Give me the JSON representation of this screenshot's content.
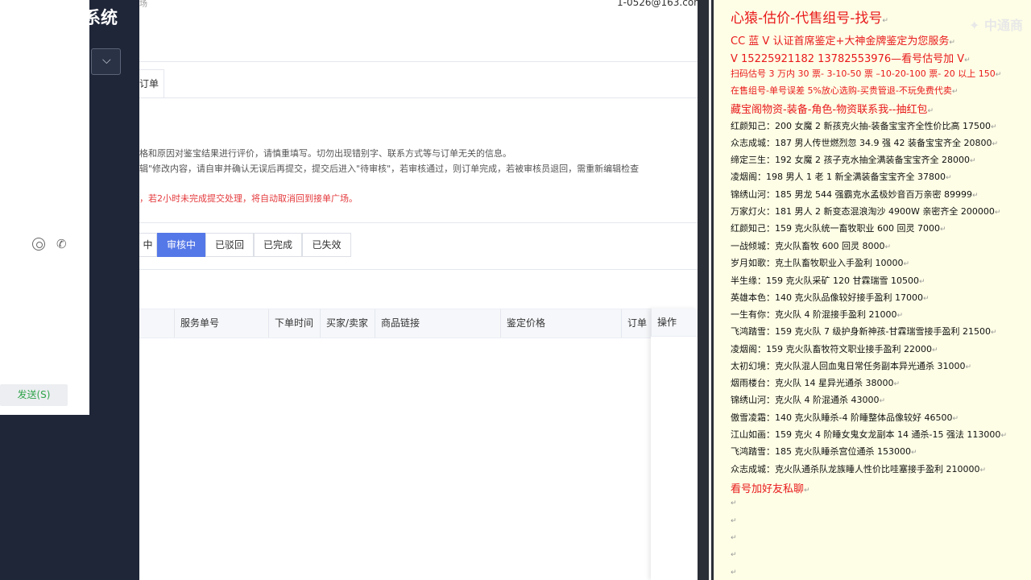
{
  "sidebar": {
    "system_title": "系统",
    "select_arrow": "⌵"
  },
  "chat": {
    "send_label": "发送(S)",
    "icons": [
      "target-icon",
      "phone-icon"
    ]
  },
  "page": {
    "top_hint": "场",
    "top_email": "1-0526@163.com",
    "order_tab": "订单",
    "notes": [
      "格和原因对鉴宝结果进行评价，请慎重填写。切勿出现错别字、联系方式等与订单无关的信息。",
      "辑\"修改内容，请自审并确认无误后再提交，提交后进入\"待审核\"，若审核通过，则订单完成，若被审核员退回，需重新编辑检查",
      "，若2小时未完成提交处理，将自动取消回到接单广场。"
    ],
    "status_tabs": [
      {
        "label": "中"
      },
      {
        "label": "审核中",
        "active": true
      },
      {
        "label": "已驳回"
      },
      {
        "label": "已完成"
      },
      {
        "label": "已失效"
      }
    ],
    "table_headers": [
      "服务单号",
      "下单时间",
      "买家/卖家",
      "商品链接",
      "鉴定价格",
      "订单"
    ],
    "action_header": "操作"
  },
  "notes_panel": {
    "watermark": "✦ 中通商",
    "title": "心猿-估价-代售组号-找号",
    "lines": [
      {
        "text": "CC 蓝 V 认证首席鉴定+大神金牌鉴定为您服务",
        "style": "red mid"
      },
      {
        "text": "V 15225921182      13782553976—看号估号加 V",
        "style": "red mid"
      },
      {
        "text": "扫码估号 3 万内 30 票- 3-10-50 票  –10-20-100 票- 20 以上 150",
        "style": "red small"
      },
      {
        "text": "在售组号-单号误差 5%放心选购-买贵管退-不玩免费代卖",
        "style": "red small"
      },
      {
        "text": "藏宝阁物资-装备-角色-物资联系我--抽红包",
        "style": "red mid"
      },
      {
        "text": "红颜知己：200 女魔 2 新孩克火抽-装备宝宝齐全性价比高 17500",
        "style": ""
      },
      {
        "text": "众志成城：187 男人传世燃烈忽 34.9 强 42 装备宝宝齐全 20800",
        "style": ""
      },
      {
        "text": "缔定三生：192 女魔 2 孩子克水抽全满装备宝宝齐全 28000",
        "style": ""
      },
      {
        "text": "凌烟阁：198 男人 1 老 1 新全满装备宝宝齐全 37800",
        "style": ""
      },
      {
        "text": "锦绣山河：185 男龙 544 强霸克水孟极妙音百万亲密 89999",
        "style": ""
      },
      {
        "text": "万家灯火：181 男人 2 新变态混浪淘沙 4900W 亲密齐全 200000",
        "style": ""
      },
      {
        "text": "红颜知己：159 克火队统一畜牧职业 600 回灵 7000",
        "style": ""
      },
      {
        "text": "一战倾城：克火队畜牧 600 回灵 8000",
        "style": ""
      },
      {
        "text": "岁月如歌：克土队畜牧职业入手盈利 10000",
        "style": ""
      },
      {
        "text": "半生缘：159 克火队采矿 120 甘霖瑞雪 10500",
        "style": ""
      },
      {
        "text": "英雄本色：140 克火队品像较好接手盈利 17000",
        "style": ""
      },
      {
        "text": "一生有你：克火队 4 阶混接手盈利 21000",
        "style": ""
      },
      {
        "text": "飞鸿踏雪：159 克火队 7 级护身新神孩-甘霖瑞雪接手盈利 21500",
        "style": ""
      },
      {
        "text": "凌烟阁：159 克火队畜牧符文职业接手盈利 22000",
        "style": ""
      },
      {
        "text": "太初幻境：克火队混人回血鬼日常任务副本异光通杀 31000",
        "style": ""
      },
      {
        "text": "烟雨楼台：克火队 14 星异光通杀 38000",
        "style": ""
      },
      {
        "text": "锦绣山河：克火队 4 阶混通杀 43000",
        "style": ""
      },
      {
        "text": "傲雪凌霜：140 克火队睡杀-4 阶睡整体品像较好 46500",
        "style": ""
      },
      {
        "text": "江山如画：159 克火 4 阶睡女鬼女龙副本 14 通杀-15 强法 113000",
        "style": ""
      },
      {
        "text": "飞鸿踏雪：185 克火队睡杀宫位通杀 153000",
        "style": ""
      },
      {
        "text": "众志成城：克火队通杀队龙族睡人性价比哇塞接手盈利 210000",
        "style": ""
      },
      {
        "text": "看号加好友私聊",
        "style": "red mid"
      }
    ],
    "paragraph_mark": "↵"
  }
}
